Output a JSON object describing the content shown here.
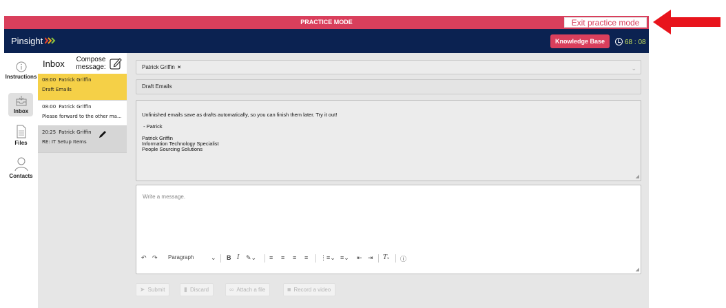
{
  "banner": {
    "title": "PRACTICE MODE",
    "exit_label": "Exit practice mode"
  },
  "topbar": {
    "brand": "Pinsight",
    "brand_mark": "›››",
    "knowledge_base": "Knowledge Base",
    "timer": "68 : 08",
    "timer_color": "#c6e05a"
  },
  "nav": {
    "items": [
      {
        "label": "Instructions",
        "icon": "info-icon"
      },
      {
        "label": "Inbox",
        "icon": "inbox-icon",
        "active": true
      },
      {
        "label": "Files",
        "icon": "file-icon"
      },
      {
        "label": "Contacts",
        "icon": "person-icon"
      }
    ]
  },
  "inbox": {
    "title": "Inbox",
    "compose_label": "Compose message:",
    "items": [
      {
        "time": "08:00",
        "sender": "Patrick Griffin",
        "subject": "Draft Emails",
        "state": "selected"
      },
      {
        "time": "08:00",
        "sender": "Patrick Griffin",
        "subject": "Please forward to the other ma...",
        "state": "normal"
      },
      {
        "time": "20:25",
        "sender": "Patrick Griffin",
        "subject": "RE: IT Setup Items",
        "state": "draft"
      }
    ]
  },
  "message": {
    "to_chip": "Patrick Griffin",
    "chip_remove": "×",
    "subject": "Draft Emails",
    "body_lines": [
      "Unfinished emails save as drafts automatically, so you can finish them later. Try it out!",
      "",
      " - Patrick",
      "",
      "Patrick Griffin",
      "Information Technology Specialist",
      "People Sourcing Solutions"
    ]
  },
  "editor": {
    "placeholder": "Write a message.",
    "paragraph_select": "Paragraph"
  },
  "actions": {
    "submit": "Submit",
    "discard": "Discard",
    "attach": "Attach a file",
    "record": "Record a video"
  },
  "colors": {
    "accent": "#d93f5c",
    "navy": "#0b2251",
    "selected": "#f5d047"
  }
}
